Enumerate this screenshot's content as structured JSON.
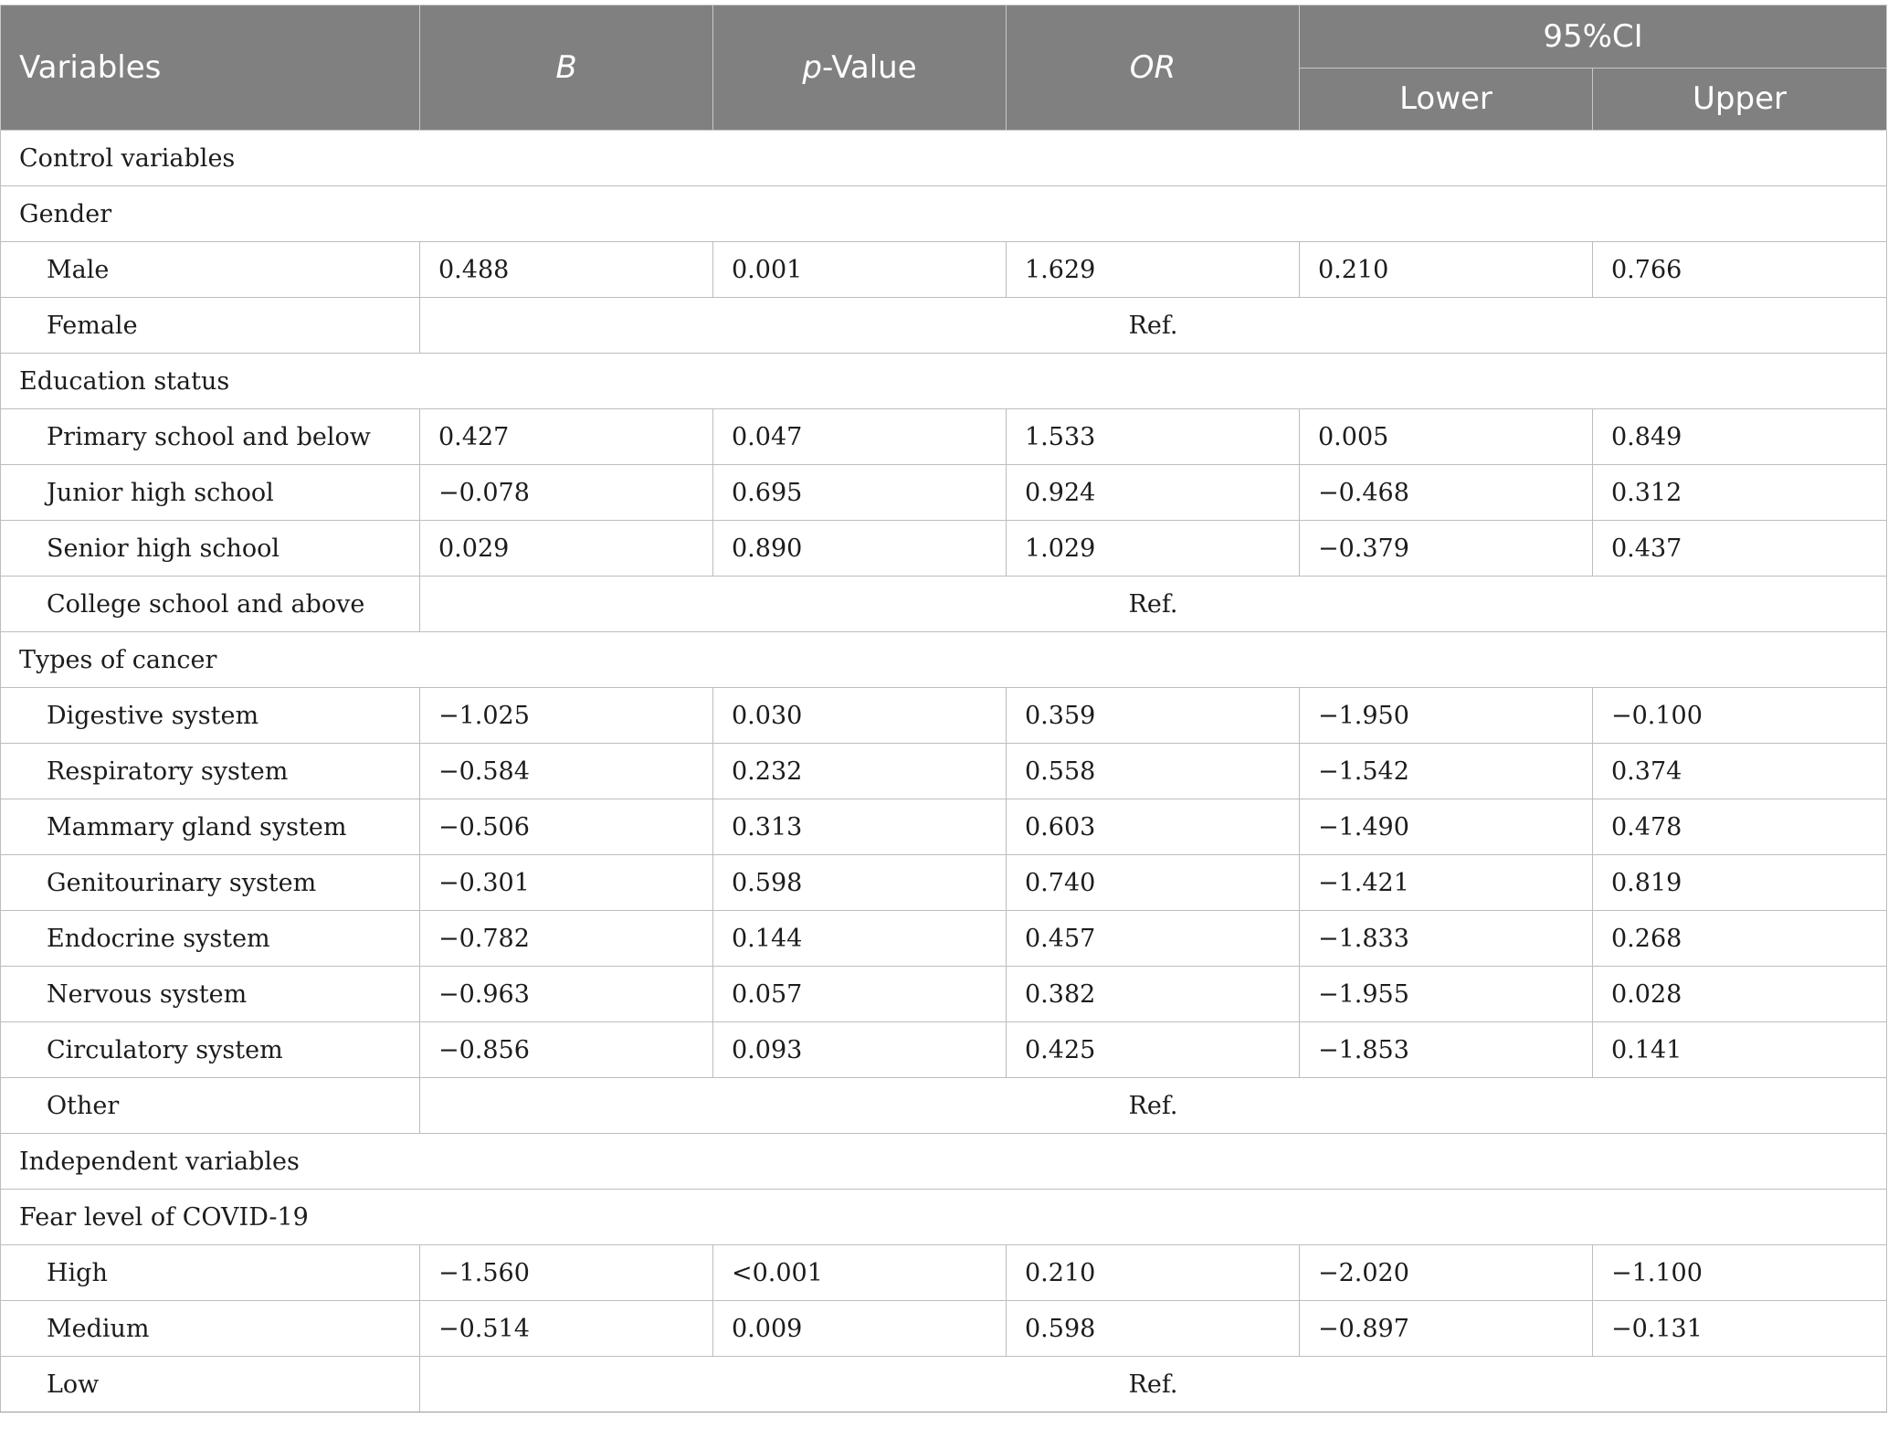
{
  "header": {
    "variables": "Variables",
    "b": "B",
    "p_prefix": "p",
    "p_suffix": "-Value",
    "or": "OR",
    "ci": "95%CI",
    "lower": "Lower",
    "upper": "Upper"
  },
  "rows": [
    {
      "type": "section",
      "label": "Control variables"
    },
    {
      "type": "section",
      "label": "Gender"
    },
    {
      "type": "data",
      "label": "Male",
      "b": "0.488",
      "p": "0.001",
      "or": "1.629",
      "lower": "0.210",
      "upper": "0.766"
    },
    {
      "type": "ref",
      "label": "Female",
      "ref": "Ref."
    },
    {
      "type": "section",
      "label": "Education status"
    },
    {
      "type": "data",
      "label": "Primary school and below",
      "b": "0.427",
      "p": "0.047",
      "or": "1.533",
      "lower": "0.005",
      "upper": "0.849"
    },
    {
      "type": "data",
      "label": "Junior high school",
      "b": "−0.078",
      "p": "0.695",
      "or": "0.924",
      "lower": "−0.468",
      "upper": "0.312"
    },
    {
      "type": "data",
      "label": "Senior high school",
      "b": "0.029",
      "p": "0.890",
      "or": "1.029",
      "lower": "−0.379",
      "upper": "0.437"
    },
    {
      "type": "ref",
      "label": "College school and above",
      "ref": "Ref."
    },
    {
      "type": "section",
      "label": "Types of cancer"
    },
    {
      "type": "data",
      "label": "Digestive system",
      "b": "−1.025",
      "p": "0.030",
      "or": "0.359",
      "lower": "−1.950",
      "upper": "−0.100"
    },
    {
      "type": "data",
      "label": "Respiratory system",
      "b": "−0.584",
      "p": "0.232",
      "or": "0.558",
      "lower": "−1.542",
      "upper": "0.374"
    },
    {
      "type": "data",
      "label": "Mammary gland system",
      "b": "−0.506",
      "p": "0.313",
      "or": "0.603",
      "lower": "−1.490",
      "upper": "0.478"
    },
    {
      "type": "data",
      "label": "Genitourinary system",
      "b": "−0.301",
      "p": "0.598",
      "or": "0.740",
      "lower": "−1.421",
      "upper": "0.819"
    },
    {
      "type": "data",
      "label": "Endocrine system",
      "b": "−0.782",
      "p": "0.144",
      "or": "0.457",
      "lower": "−1.833",
      "upper": "0.268"
    },
    {
      "type": "data",
      "label": "Nervous system",
      "b": "−0.963",
      "p": "0.057",
      "or": "0.382",
      "lower": "−1.955",
      "upper": "0.028"
    },
    {
      "type": "data",
      "label": "Circulatory system",
      "b": "−0.856",
      "p": "0.093",
      "or": "0.425",
      "lower": "−1.853",
      "upper": "0.141"
    },
    {
      "type": "ref",
      "label": "Other",
      "ref": "Ref."
    },
    {
      "type": "section",
      "label": "Independent variables"
    },
    {
      "type": "section",
      "label": "Fear level of COVID-19"
    },
    {
      "type": "data",
      "label": "High",
      "b": "−1.560",
      "p": "<0.001",
      "or": "0.210",
      "lower": "−2.020",
      "upper": "−1.100"
    },
    {
      "type": "data",
      "label": "Medium",
      "b": "−0.514",
      "p": "0.009",
      "or": "0.598",
      "lower": "−0.897",
      "upper": "−0.131"
    },
    {
      "type": "ref",
      "label": "Low",
      "ref": "Ref."
    }
  ]
}
